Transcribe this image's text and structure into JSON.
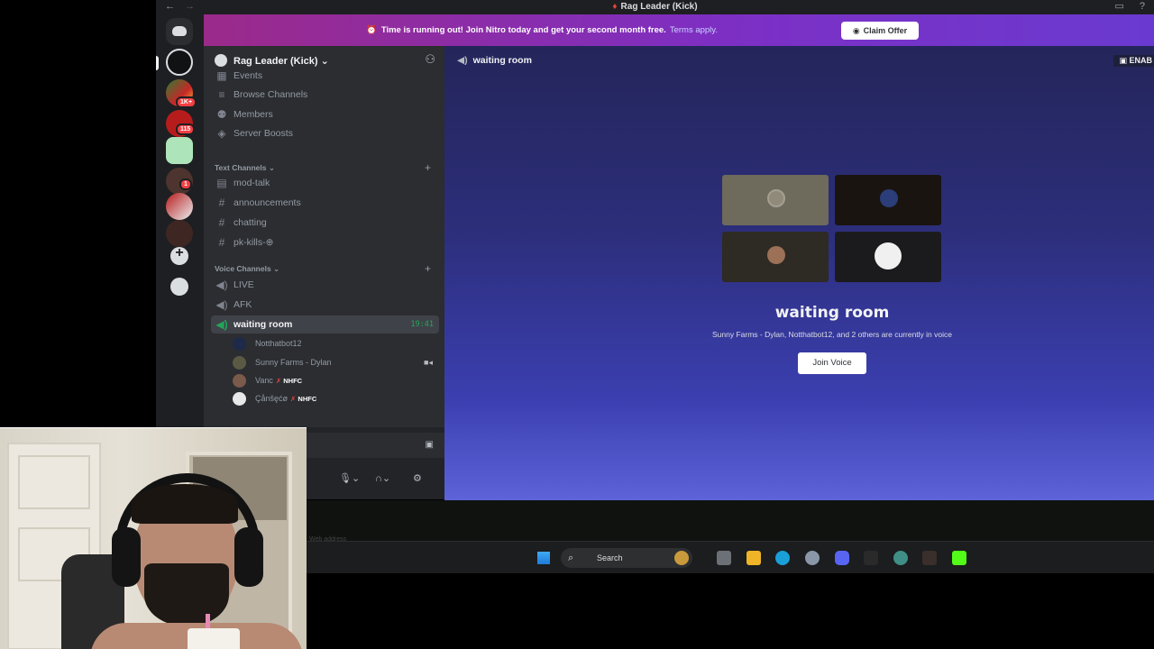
{
  "window": {
    "title": "Rag Leader (Kick)",
    "back": "←",
    "forward": "→"
  },
  "banner": {
    "message": "Time is running out! Join Nitro today and get your second month free.",
    "terms_link": "Terms apply.",
    "claim_button": "Claim Offer"
  },
  "rail": {
    "badges": [
      "1K+",
      "115",
      "1"
    ]
  },
  "server": {
    "name": "Rag Leader (Kick)",
    "chevron": "⌄"
  },
  "sidebar": {
    "top_items": [
      {
        "label": "Events",
        "icon": "calendar-icon"
      },
      {
        "label": "Browse Channels",
        "icon": "list-icon"
      },
      {
        "label": "Members",
        "icon": "members-icon"
      },
      {
        "label": "Server Boosts",
        "icon": "boost-icon"
      }
    ],
    "text_category": "Text Channels",
    "text_channels": [
      "mod-talk",
      "announcements",
      "chatting",
      "pk-kills-⊕"
    ],
    "voice_category": "Voice Channels",
    "voice_channels": [
      {
        "name": "LIVE"
      },
      {
        "name": "AFK"
      },
      {
        "name": "waiting room",
        "time": "19:41"
      }
    ],
    "voice_users": [
      {
        "name": "Notthatbot12",
        "tag": ""
      },
      {
        "name": "Sunny Farms - Dylan",
        "tag": ""
      },
      {
        "name": "Vanc",
        "tag": "NHFC"
      },
      {
        "name": "Çånšęćø",
        "tag": "NHFC"
      }
    ]
  },
  "main": {
    "channel": "waiting room",
    "enable_label": "ENAB",
    "voice_title": "waiting room",
    "voice_subtitle": "Sunny Farms - Dylan, Notthatbot12, and 2 others are currently in voice",
    "join_button": "Join Voice"
  },
  "taskbar": {
    "search_label": "Search",
    "address_hint": "Web address"
  }
}
